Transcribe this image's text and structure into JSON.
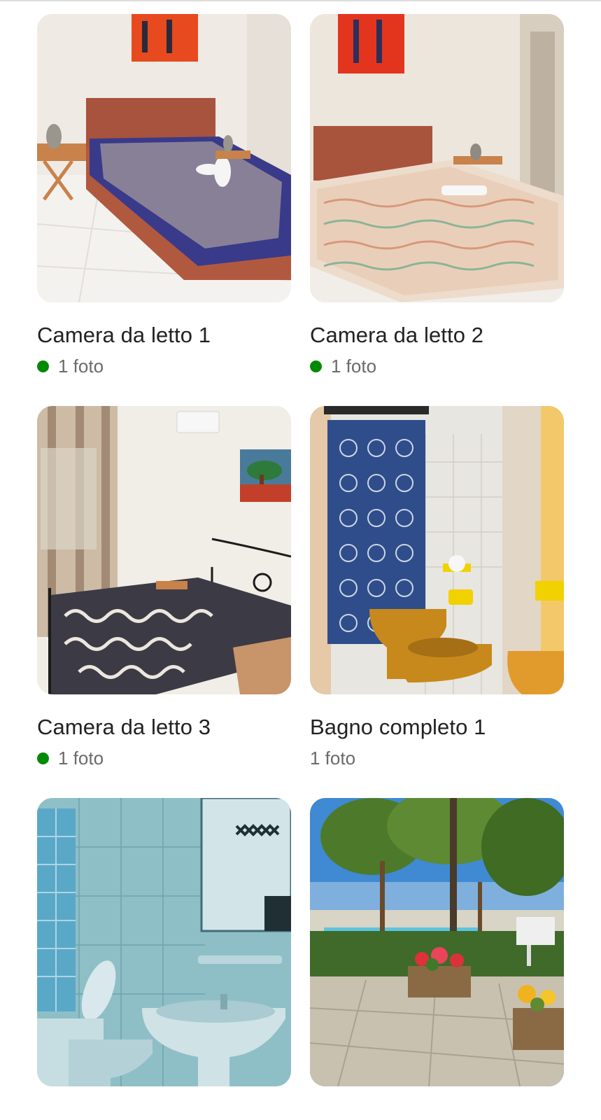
{
  "rooms": [
    {
      "title": "Camera da letto 1",
      "photo_count_label": "1 foto",
      "status_dot": true,
      "status_color": "#008a05",
      "image_alt": "bedroom-1-photo"
    },
    {
      "title": "Camera da letto 2",
      "photo_count_label": "1 foto",
      "status_dot": true,
      "status_color": "#008a05",
      "image_alt": "bedroom-2-photo"
    },
    {
      "title": "Camera da letto 3",
      "photo_count_label": "1 foto",
      "status_dot": true,
      "status_color": "#008a05",
      "image_alt": "bedroom-3-photo"
    },
    {
      "title": "Bagno completo 1",
      "photo_count_label": "1 foto",
      "status_dot": false,
      "image_alt": "bathroom-1-photo"
    },
    {
      "title": "",
      "photo_count_label": "",
      "status_dot": false,
      "image_alt": "bathroom-2-photo"
    },
    {
      "title": "",
      "photo_count_label": "",
      "status_dot": false,
      "image_alt": "garden-pool-photo"
    }
  ]
}
